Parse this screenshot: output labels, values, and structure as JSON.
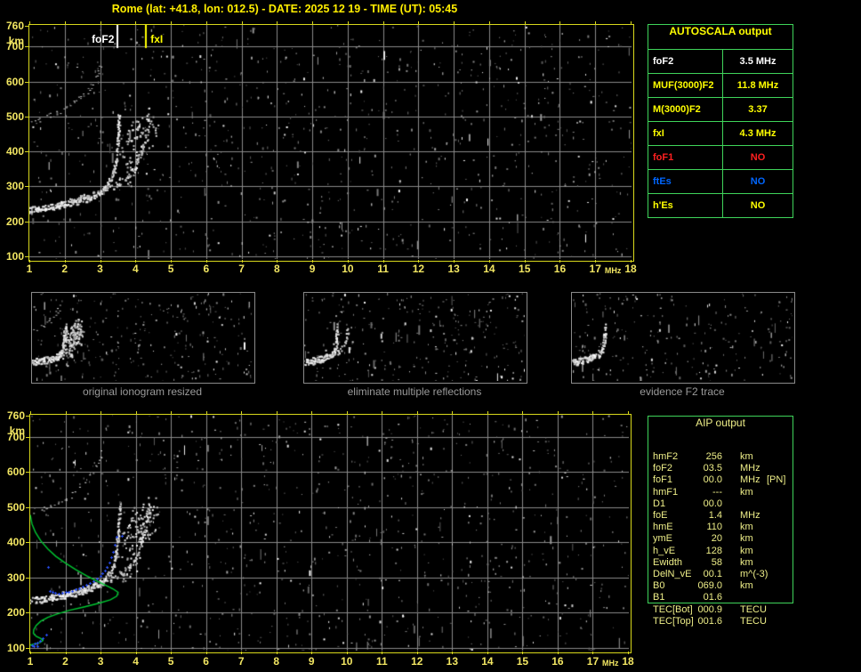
{
  "title": "Rome (lat: +41.8, lon: 012.5) - DATE: 2025 12 19 - TIME (UT): 05:45",
  "colors": {
    "background": "#000000",
    "title_yellow": "#ffee00",
    "axis_yellow": "#f2e662",
    "plot_border_yellow": "#d8d81c",
    "grid_gray": "#8a8a8a",
    "table_border_green": "#3fd45a",
    "profile_green": "#00c832",
    "scaled_points_blue": "#2a50ff",
    "aip_text": "#eeee88",
    "caption_gray": "#9a9a9a"
  },
  "autoscala_table": {
    "header": "AUTOSCALA output",
    "rows": [
      {
        "param": "foF2",
        "value": "3.5 MHz",
        "color": "#ffffff"
      },
      {
        "param": "MUF(3000)F2",
        "value": "11.8 MHz",
        "color": "#ffff00"
      },
      {
        "param": "M(3000)F2",
        "value": "3.37",
        "color": "#ffff00"
      },
      {
        "param": "fxI",
        "value": "4.3 MHz",
        "color": "#ffff00"
      },
      {
        "param": "foF1",
        "value": "NO",
        "color": "#ff2020"
      },
      {
        "param": "ftEs",
        "value": "NO",
        "color": "#0066ff"
      },
      {
        "param": "h'Es",
        "value": "NO",
        "color": "#ffff00"
      }
    ]
  },
  "aip_table": {
    "header": "AIP output",
    "rows": [
      {
        "param": "hmF2",
        "value": "256",
        "unit": "km",
        "note": ""
      },
      {
        "param": "foF2",
        "value": "03.5",
        "unit": "MHz",
        "note": ""
      },
      {
        "param": "foF1",
        "value": "00.0",
        "unit": "MHz",
        "note": "[PN]"
      },
      {
        "param": "hmF1",
        "value": "---",
        "unit": "km",
        "note": ""
      },
      {
        "param": "D1",
        "value": "00.0",
        "unit": "",
        "note": ""
      },
      {
        "param": "foE",
        "value": "1.4",
        "unit": "MHz",
        "note": ""
      },
      {
        "param": "hmE",
        "value": "110",
        "unit": "km",
        "note": ""
      },
      {
        "param": "ymE",
        "value": "20",
        "unit": "km",
        "note": ""
      },
      {
        "param": "h_vE",
        "value": "128",
        "unit": "km",
        "note": ""
      },
      {
        "param": "Ewidth",
        "value": "58",
        "unit": "km",
        "note": ""
      },
      {
        "param": "DelN_vE",
        "value": "00.1",
        "unit": "m^(-3)",
        "note": ""
      },
      {
        "param": "B0",
        "value": "069.0",
        "unit": "km",
        "note": ""
      },
      {
        "param": "B1",
        "value": "01.6",
        "unit": "",
        "note": ""
      },
      {
        "param": "TEC[Bot]",
        "value": "000.9",
        "unit": "TECU",
        "note": ""
      },
      {
        "param": "TEC[Top]",
        "value": "001.6",
        "unit": "TECU",
        "note": ""
      }
    ]
  },
  "thumbnails": [
    {
      "caption": "original ionogram resized"
    },
    {
      "caption": "eliminate multiple reflections"
    },
    {
      "caption": "evidence F2 trace"
    }
  ],
  "chart_data": [
    {
      "id": "scaled-ionogram",
      "type": "scatter",
      "xlabel": "MHz",
      "ylabel": "km",
      "xlim": [
        1,
        18
      ],
      "ylim": [
        100,
        760
      ],
      "xticks": [
        1,
        2,
        3,
        4,
        5,
        6,
        7,
        8,
        9,
        10,
        11,
        12,
        13,
        14,
        15,
        16,
        17,
        18
      ],
      "yticks": [
        760,
        700,
        600,
        500,
        400,
        300,
        200,
        100
      ],
      "grid": true,
      "markers": [
        {
          "name": "foF2",
          "f": 3.5,
          "color": "#ffffff"
        },
        {
          "name": "fxI",
          "f": 4.3,
          "color": "#ffff00"
        }
      ],
      "series": [
        {
          "name": "F2-trace-o-mode",
          "points": [
            [
              1.0,
              236
            ],
            [
              1.2,
              238
            ],
            [
              1.4,
              241
            ],
            [
              1.6,
              244
            ],
            [
              1.8,
              248
            ],
            [
              2.0,
              252
            ],
            [
              2.2,
              257
            ],
            [
              2.4,
              262
            ],
            [
              2.6,
              268
            ],
            [
              2.8,
              276
            ],
            [
              3.0,
              286
            ],
            [
              3.1,
              294
            ],
            [
              3.2,
              305
            ],
            [
              3.3,
              322
            ],
            [
              3.38,
              345
            ],
            [
              3.44,
              375
            ],
            [
              3.48,
              420
            ],
            [
              3.51,
              465
            ],
            [
              3.53,
              505
            ]
          ]
        },
        {
          "name": "F2-trace-x-mode",
          "points": [
            [
              2.1,
              262
            ],
            [
              2.4,
              268
            ],
            [
              2.7,
              276
            ],
            [
              3.0,
              286
            ],
            [
              3.3,
              298
            ],
            [
              3.6,
              314
            ],
            [
              3.8,
              330
            ],
            [
              3.95,
              350
            ],
            [
              4.05,
              372
            ],
            [
              4.15,
              400
            ],
            [
              4.25,
              435
            ],
            [
              4.32,
              470
            ],
            [
              4.36,
              495
            ]
          ]
        },
        {
          "name": "multiple-reflection",
          "points": [
            [
              1.0,
              483
            ],
            [
              1.2,
              489
            ],
            [
              1.4,
              496
            ],
            [
              1.6,
              504
            ],
            [
              1.8,
              513
            ],
            [
              2.0,
              524
            ],
            [
              2.2,
              537
            ],
            [
              2.4,
              553
            ],
            [
              2.6,
              573
            ],
            [
              2.75,
              593
            ],
            [
              2.87,
              615
            ],
            [
              2.97,
              640
            ],
            [
              3.05,
              665
            ]
          ]
        },
        {
          "name": "spread-F-echoes",
          "points": [
            [
              3.7,
              310
            ],
            [
              3.85,
              340
            ],
            [
              3.95,
              370
            ],
            [
              4.05,
              400
            ],
            [
              4.15,
              430
            ],
            [
              4.25,
              460
            ],
            [
              4.35,
              490
            ],
            [
              4.45,
              510
            ],
            [
              3.75,
              420
            ],
            [
              3.9,
              450
            ],
            [
              4.0,
              480
            ],
            [
              4.5,
              470
            ],
            [
              4.4,
              430
            ],
            [
              3.65,
              380
            ]
          ]
        }
      ]
    },
    {
      "id": "aip-ionogram",
      "type": "scatter",
      "xlabel": "MHz",
      "ylabel": "km",
      "xlim": [
        1,
        18
      ],
      "ylim": [
        100,
        760
      ],
      "xticks": [
        1,
        2,
        3,
        4,
        5,
        6,
        7,
        8,
        9,
        10,
        11,
        12,
        13,
        14,
        15,
        16,
        17,
        18
      ],
      "yticks": [
        760,
        700,
        600,
        500,
        400,
        300,
        200,
        100
      ],
      "grid": true,
      "markers": [],
      "series": [
        {
          "name": "F2-trace-o-mode",
          "points": [
            [
              1.0,
              236
            ],
            [
              1.2,
              238
            ],
            [
              1.4,
              241
            ],
            [
              1.6,
              244
            ],
            [
              1.8,
              248
            ],
            [
              2.0,
              252
            ],
            [
              2.2,
              257
            ],
            [
              2.4,
              262
            ],
            [
              2.6,
              268
            ],
            [
              2.8,
              276
            ],
            [
              3.0,
              286
            ],
            [
              3.1,
              294
            ],
            [
              3.2,
              305
            ],
            [
              3.3,
              322
            ],
            [
              3.38,
              345
            ],
            [
              3.44,
              375
            ],
            [
              3.48,
              420
            ],
            [
              3.51,
              465
            ],
            [
              3.53,
              505
            ]
          ]
        },
        {
          "name": "F2-trace-x-mode",
          "points": [
            [
              2.1,
              262
            ],
            [
              2.4,
              268
            ],
            [
              2.7,
              276
            ],
            [
              3.0,
              286
            ],
            [
              3.3,
              298
            ],
            [
              3.6,
              314
            ],
            [
              3.8,
              330
            ],
            [
              3.95,
              350
            ],
            [
              4.05,
              372
            ],
            [
              4.15,
              400
            ],
            [
              4.25,
              435
            ],
            [
              4.32,
              470
            ],
            [
              4.36,
              495
            ]
          ]
        },
        {
          "name": "multiple-reflection",
          "points": [
            [
              1.0,
              483
            ],
            [
              1.2,
              489
            ],
            [
              1.4,
              496
            ],
            [
              1.6,
              504
            ],
            [
              1.8,
              513
            ],
            [
              2.0,
              524
            ],
            [
              2.2,
              537
            ],
            [
              2.4,
              553
            ],
            [
              2.6,
              573
            ],
            [
              2.75,
              593
            ],
            [
              2.87,
              615
            ],
            [
              2.97,
              640
            ],
            [
              3.05,
              665
            ]
          ]
        },
        {
          "name": "spread-F-echoes",
          "points": [
            [
              3.7,
              310
            ],
            [
              3.85,
              340
            ],
            [
              3.95,
              370
            ],
            [
              4.05,
              400
            ],
            [
              4.15,
              430
            ],
            [
              4.25,
              460
            ],
            [
              4.35,
              490
            ],
            [
              4.45,
              510
            ],
            [
              3.75,
              420
            ],
            [
              3.9,
              450
            ],
            [
              4.0,
              480
            ],
            [
              4.5,
              470
            ],
            [
              4.4,
              430
            ],
            [
              3.65,
              380
            ]
          ]
        },
        {
          "name": "electron-density-profile",
          "color": "#00c832",
          "points": [
            [
              1.0,
              478
            ],
            [
              1.05,
              452
            ],
            [
              1.15,
              428
            ],
            [
              1.3,
              404
            ],
            [
              1.5,
              381
            ],
            [
              1.73,
              360
            ],
            [
              2.0,
              341
            ],
            [
              2.3,
              322
            ],
            [
              2.6,
              305
            ],
            [
              2.9,
              290
            ],
            [
              3.15,
              278
            ],
            [
              3.35,
              268
            ],
            [
              3.5,
              258
            ],
            [
              3.46,
              247
            ],
            [
              3.28,
              237
            ],
            [
              2.95,
              227
            ],
            [
              2.55,
              217
            ],
            [
              2.12,
              207
            ],
            [
              1.78,
              197
            ],
            [
              1.5,
              187
            ],
            [
              1.3,
              176
            ],
            [
              1.17,
              164
            ],
            [
              1.1,
              152
            ],
            [
              1.09,
              142
            ],
            [
              1.17,
              133
            ],
            [
              1.3,
              127
            ],
            [
              1.36,
              121
            ],
            [
              1.27,
              115
            ],
            [
              1.1,
              111
            ],
            [
              1.0,
              108
            ]
          ]
        },
        {
          "name": "autoscaled-trace-points",
          "color": "#2a50ff",
          "points": [
            [
              1.5,
              330
            ],
            [
              1.55,
              262
            ],
            [
              1.62,
              258
            ],
            [
              1.7,
              256
            ],
            [
              1.8,
              255
            ],
            [
              1.9,
              256
            ],
            [
              2.0,
              258
            ],
            [
              2.1,
              260
            ],
            [
              2.2,
              263
            ],
            [
              2.3,
              266
            ],
            [
              2.4,
              270
            ],
            [
              2.5,
              274
            ],
            [
              2.6,
              279
            ],
            [
              2.7,
              284
            ],
            [
              2.8,
              290
            ],
            [
              2.9,
              297
            ],
            [
              3.0,
              305
            ],
            [
              3.06,
              313
            ],
            [
              3.12,
              321
            ],
            [
              3.18,
              331
            ],
            [
              3.24,
              343
            ],
            [
              3.3,
              357
            ],
            [
              3.36,
              373
            ],
            [
              3.41,
              392
            ],
            [
              3.45,
              415
            ],
            [
              3.6,
              418
            ],
            [
              1.45,
              138
            ],
            [
              1.35,
              127
            ],
            [
              1.28,
              120
            ],
            [
              1.2,
              116
            ],
            [
              1.12,
              112
            ],
            [
              1.05,
              108
            ],
            [
              1.1,
              104
            ],
            [
              1.2,
              106
            ]
          ]
        }
      ]
    }
  ]
}
